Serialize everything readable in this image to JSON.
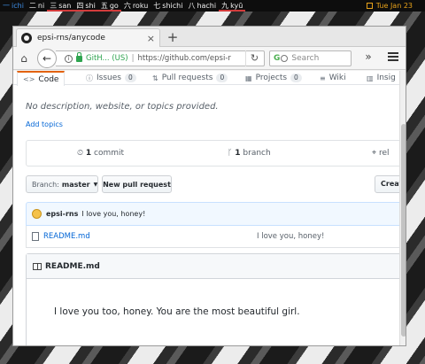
{
  "topbar": {
    "workspaces": [
      {
        "kanji": "一",
        "label": "ichi",
        "state": "active"
      },
      {
        "kanji": "二",
        "label": "ni",
        "state": "normal"
      },
      {
        "kanji": "三",
        "label": "san",
        "state": "occupied"
      },
      {
        "kanji": "四",
        "label": "shi",
        "state": "occupied"
      },
      {
        "kanji": "五",
        "label": "go",
        "state": "occupied"
      },
      {
        "kanji": "六",
        "label": "roku",
        "state": "normal"
      },
      {
        "kanji": "七",
        "label": "shichi",
        "state": "normal"
      },
      {
        "kanji": "八",
        "label": "hachi",
        "state": "normal"
      },
      {
        "kanji": "九",
        "label": "kyū",
        "state": "occupied"
      }
    ],
    "clock": "Tue Jan 23",
    "colors": {
      "active": "#3f8fe8",
      "occupied_underline": "#d23b3b",
      "clock": "#e8a21a"
    }
  },
  "browser": {
    "tab_title": "epsi-rns/anycode",
    "tab_close": "×",
    "new_tab": "+",
    "url_org": "GitH... (US)",
    "url_text": "https://github.com/epsi-r",
    "search_placeholder": "Search",
    "search_g": "G",
    "home_icon": "⌂",
    "back_icon": "←",
    "reload_icon": "↻",
    "overflow_icon": "»"
  },
  "repo": {
    "tabs": [
      {
        "icon": "<>",
        "label": "Code",
        "count": null,
        "selected": true
      },
      {
        "icon": "ⓘ",
        "label": "Issues",
        "count": "0",
        "selected": false
      },
      {
        "icon": "⇅",
        "label": "Pull requests",
        "count": "0",
        "selected": false
      },
      {
        "icon": "▦",
        "label": "Projects",
        "count": "0",
        "selected": false
      },
      {
        "icon": "≡",
        "label": "Wiki",
        "count": null,
        "selected": false
      },
      {
        "icon": "▥",
        "label": "Insig",
        "count": null,
        "selected": false
      }
    ],
    "description": "No description, website, or topics provided.",
    "add_topics": "Add topics",
    "summary": {
      "commits_count": "1",
      "commits_label": "commit",
      "branches_count": "1",
      "branches_label": "branch",
      "releases_label": "rel"
    },
    "branch_button": {
      "prefix": "Branch:",
      "name": "master"
    },
    "new_pr_label": "New pull request",
    "create_label": "Create new file",
    "commit": {
      "author": "epsi-rns",
      "message": "I love you, honey!"
    },
    "files": [
      {
        "name": "README.md",
        "message": "I love you, honey!"
      }
    ],
    "readme": {
      "title": "README.md",
      "body": "I love you too, honey. You are the most beautiful girl."
    }
  }
}
